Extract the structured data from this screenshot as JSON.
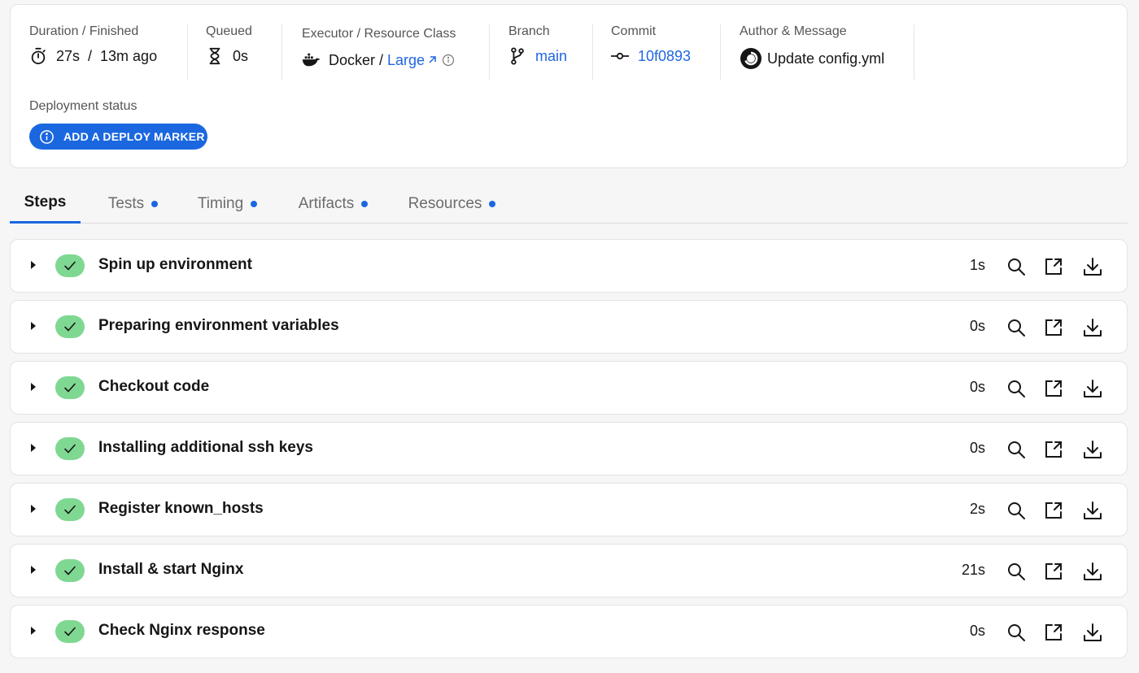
{
  "summary": {
    "duration": {
      "label": "Duration / Finished",
      "value": "27s  /  13m ago",
      "icon": "stopwatch-icon"
    },
    "queued": {
      "label": "Queued",
      "value": "0s",
      "icon": "hourglass-icon"
    },
    "executor": {
      "label": "Executor / Resource Class",
      "executor": "Docker / ",
      "resource_class": "Large",
      "icon": "docker-icon"
    },
    "branch": {
      "label": "Branch",
      "value": "main",
      "icon": "git-branch-icon"
    },
    "commit": {
      "label": "Commit",
      "value": "10f0893",
      "icon": "git-commit-icon"
    },
    "author": {
      "label": "Author & Message",
      "message": "Update config.yml",
      "icon": "circleci-logo-icon"
    },
    "deployment": {
      "label": "Deployment status",
      "button": "ADD A DEPLOY MARKER"
    }
  },
  "tabs": [
    {
      "label": "Steps",
      "active": true,
      "indicator": false
    },
    {
      "label": "Tests",
      "active": false,
      "indicator": true
    },
    {
      "label": "Timing",
      "active": false,
      "indicator": true
    },
    {
      "label": "Artifacts",
      "active": false,
      "indicator": true
    },
    {
      "label": "Resources",
      "active": false,
      "indicator": true
    }
  ],
  "steps": [
    {
      "title": "Spin up environment",
      "duration": "1s",
      "status": "success"
    },
    {
      "title": "Preparing environment variables",
      "duration": "0s",
      "status": "success"
    },
    {
      "title": "Checkout code",
      "duration": "0s",
      "status": "success"
    },
    {
      "title": "Installing additional ssh keys",
      "duration": "0s",
      "status": "success"
    },
    {
      "title": "Register known_hosts",
      "duration": "2s",
      "status": "success"
    },
    {
      "title": "Install & start Nginx",
      "duration": "21s",
      "status": "success"
    },
    {
      "title": "Check Nginx response",
      "duration": "0s",
      "status": "success"
    }
  ],
  "colors": {
    "accent": "#1a67e0",
    "link": "#2066e1",
    "success_pill": "#7fd892"
  }
}
